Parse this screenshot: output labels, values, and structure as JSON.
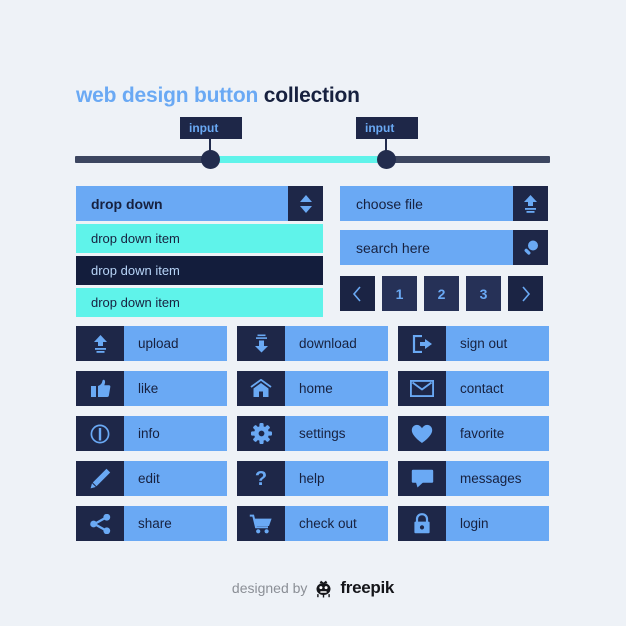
{
  "title": {
    "highlight": "web design button",
    "rest": "collection"
  },
  "slider": {
    "tooltip_left": "input",
    "tooltip_right": "input",
    "track_color": "#3c4660",
    "fill_color": "#5ff3ea",
    "handle_color": "#222c4d"
  },
  "dropdown": {
    "header_label": "drop down",
    "toggle_icon": "chevron-up-down-icon",
    "items": [
      {
        "label": "drop down item",
        "selected": false
      },
      {
        "label": "drop down item",
        "selected": true
      },
      {
        "label": "drop down item",
        "selected": false
      }
    ]
  },
  "fields": [
    {
      "value": "choose file",
      "icon": "upload-icon",
      "name": "choose-file-field"
    },
    {
      "value": "search here",
      "icon": "search-icon",
      "name": "search-field"
    }
  ],
  "pagination": {
    "prev_icon": "chevron-left-icon",
    "next_icon": "chevron-right-icon",
    "pages": [
      "1",
      "2",
      "3"
    ]
  },
  "buttons": [
    {
      "label": "upload",
      "icon": "upload-icon"
    },
    {
      "label": "download",
      "icon": "download-icon"
    },
    {
      "label": "sign out",
      "icon": "sign-out-icon"
    },
    {
      "label": "like",
      "icon": "thumbs-up-icon"
    },
    {
      "label": "home",
      "icon": "home-icon"
    },
    {
      "label": "contact",
      "icon": "envelope-icon"
    },
    {
      "label": "info",
      "icon": "info-icon"
    },
    {
      "label": "settings",
      "icon": "gear-icon"
    },
    {
      "label": "favorite",
      "icon": "heart-icon"
    },
    {
      "label": "edit",
      "icon": "pencil-icon"
    },
    {
      "label": "help",
      "icon": "question-mark-icon"
    },
    {
      "label": "messages",
      "icon": "speech-bubble-icon"
    },
    {
      "label": "share",
      "icon": "share-icon"
    },
    {
      "label": "check out",
      "icon": "shopping-cart-icon"
    },
    {
      "label": "login",
      "icon": "lock-icon"
    }
  ],
  "footer": {
    "designed_by": "designed by",
    "brand": "freepik",
    "logo_icon": "freepik-logo-icon"
  },
  "colors": {
    "background": "#eef2f7",
    "blue": "#6aa9f4",
    "cyan": "#5ff3ea",
    "navy": "#1e2748",
    "navy_dark": "#131d3c",
    "text_dark": "#17213f"
  }
}
